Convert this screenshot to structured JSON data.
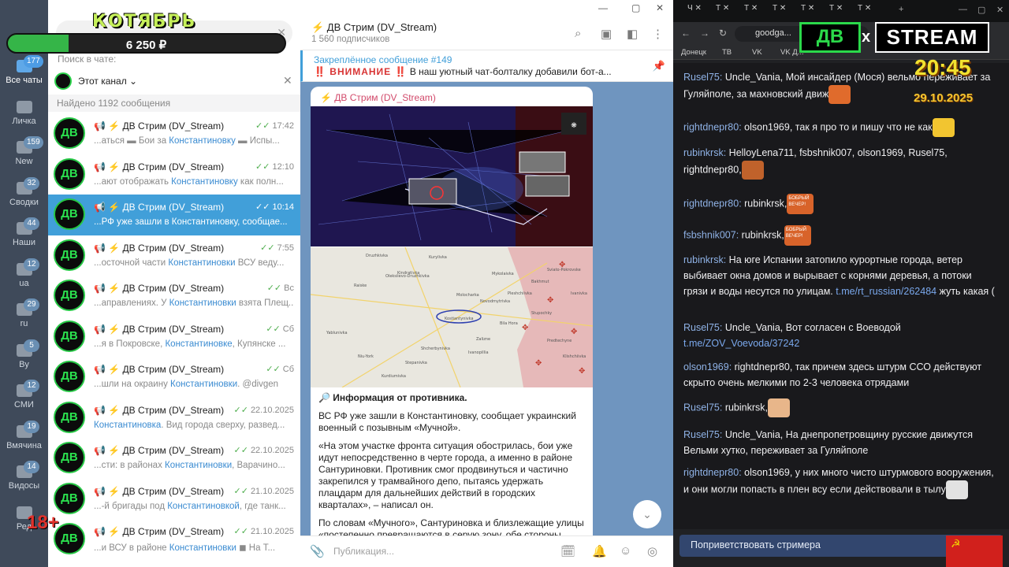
{
  "overlay": {
    "month_title": "КОТЯБРЬ",
    "goal_amount": "6 250 ₽",
    "goal_progress_percent": 22,
    "age_rating": "18+"
  },
  "folders": [
    {
      "label": "Все чаты",
      "badge": "177",
      "active": true
    },
    {
      "label": "Личка",
      "badge": ""
    },
    {
      "label": "New",
      "badge": "159"
    },
    {
      "label": "Сводки",
      "badge": "32"
    },
    {
      "label": "Наши",
      "badge": "44"
    },
    {
      "label": "ua",
      "badge": "12"
    },
    {
      "label": "ru",
      "badge": "29"
    },
    {
      "label": "By",
      "badge": "5"
    },
    {
      "label": "СМИ",
      "badge": "12"
    },
    {
      "label": "Вмячина",
      "badge": "19"
    },
    {
      "label": "Видосы",
      "badge": "14"
    },
    {
      "label": "Ред",
      "badge": ""
    }
  ],
  "search": {
    "in_chat_label": "Поиск в чате:",
    "channel_filter": "Этот канал",
    "found_count": "Найдено 1192 сообщения"
  },
  "results": [
    {
      "title": "📢 ⚡ ДВ Стрим (DV_Stream)",
      "time": "17:42",
      "pre": "...аться ▬ Бои за ",
      "hl": "Константиновку",
      "post": " ▬ Испы..."
    },
    {
      "title": "📢 ⚡ ДВ Стрим (DV_Stream)",
      "time": "12:10",
      "pre": "...ают отображать ",
      "hl": "Константиновку",
      "post": " как полн..."
    },
    {
      "title": "📢 ⚡ ДВ Стрим (DV_Stream)",
      "time": "10:14",
      "pre": "...РФ уже зашли в Константиновку, сообщае...",
      "hl": "",
      "post": "",
      "active": true
    },
    {
      "title": "📢 ⚡ ДВ Стрим (DV_Stream)",
      "time": "7:55",
      "pre": "...осточной части ",
      "hl": "Константиновки",
      "post": " ВСУ веду..."
    },
    {
      "title": "📢 ⚡ ДВ Стрим (DV_Stream)",
      "time": "Вс",
      "pre": "...аправлениях. У ",
      "hl": "Константиновки",
      "post": " взята Плещ..."
    },
    {
      "title": "📢 ⚡ ДВ Стрим (DV_Stream)",
      "time": "Сб",
      "pre": "...я в Покровске, ",
      "hl": "Константиновке",
      "post": ", Купянске ..."
    },
    {
      "title": "📢 ⚡ ДВ Стрим (DV_Stream)",
      "time": "Сб",
      "pre": "...шли на окраину ",
      "hl": "Константиновки",
      "post": ". @divgen"
    },
    {
      "title": "📢 ⚡ ДВ Стрим (DV_Stream)",
      "time": "22.10.2025",
      "pre": "",
      "hl": "Константиновка",
      "post": ". Вид города сверху, развед..."
    },
    {
      "title": "📢 ⚡ ДВ Стрим (DV_Stream)",
      "time": "22.10.2025",
      "pre": "...сти: в районах ",
      "hl": "Константиновки",
      "post": ", Варачино..."
    },
    {
      "title": "📢 ⚡ ДВ Стрим (DV_Stream)",
      "time": "21.10.2025",
      "pre": "...-й бригады под ",
      "hl": "Константиновкой",
      "post": ", где танк..."
    },
    {
      "title": "📢 ⚡ ДВ Стрим (DV_Stream)",
      "time": "21.10.2025",
      "pre": "...и ВСУ в районе ",
      "hl": "Константиновки",
      "post": " ◼ На Т..."
    }
  ],
  "chat": {
    "name": "⚡ ДВ Стрим (DV_Stream)",
    "subscribers": "1 560 подписчиков",
    "pinned_title": "Закреплённое сообщение #149",
    "pinned_warn": "‼️ ВНИМАНИЕ ‼️",
    "pinned_text": "В наш уютный чат-болталку добавили бот-а...",
    "sender": "⚡ ДВ Стрим (DV_Stream)",
    "info_heading": "🔎 Информация от противника.",
    "para1": "ВС РФ уже зашли в Константиновку, сообщает украинский военный с позывным «Мучной».",
    "para2": "«На этом участке фронта ситуация обострилась, бои уже идут непосредственно в черте города, а именно в районе Сантуриновки. Противник смог продвинуться и частично закрепился у трамвайного депо, пытаясь удержать плацдарм для дальнейших действий в городских кварталах», – написал он.",
    "para3": "По словам «Мучного», Сантуриновка и близлежащие улицы «постепенно превращаются в серую зону, обе стороны несут...",
    "composer_placeholder": "Публикация..."
  },
  "map_labels": [
    "Druzhkivka",
    "Kurylivka",
    "Oleksiievo-Druzhkivka",
    "Kindrativka",
    "Raiske",
    "Mykolaivka",
    "Molocharka",
    "Novodmytrivka",
    "Kostiantynivka",
    "Stupochky",
    "Bila Hora",
    "Zalizne",
    "Ivanopillia",
    "Shcherbynivka",
    "Niu-York",
    "Stepanivka",
    "Kurdiumivka",
    "Predtechyne",
    "Klishchiivka",
    "Bakhmut",
    "Sviato-Pokrovske",
    "Ivanivka",
    "Pleshchiivka",
    "Yablunivka"
  ],
  "browser": {
    "tabs": [
      "Ч",
      "Т",
      "Т",
      "Т",
      "Т",
      "Т",
      "Т"
    ],
    "url": "goodga...",
    "bookmarks": [
      "Донецк",
      "ТВ",
      "VK",
      "VK Д..."
    ]
  },
  "stream_logo": {
    "left": "ДВ",
    "x": "x",
    "right": "STREAM"
  },
  "clock": {
    "time": "20:45",
    "date": "29.10.2025"
  },
  "stream_chat": [
    {
      "user": "Rusel75:",
      "text": " Uncle_Vania, Мой инсайдер (Мося) вельмо переживает за Гуляйполе, за махновский движ",
      "emote": "worker"
    },
    {
      "user": "rightdnepr80:",
      "text": " olson1969, так я про то и пишу что не как",
      "emote": "smile"
    },
    {
      "user": "rubinkrsk:",
      "text": " HelloyLena711, fsbshnik007, olson1969, Rusel75, rightdnepr80,",
      "emote": "bear"
    },
    {
      "user": "rightdnepr80:",
      "text": " rubinkrsk,",
      "emote": "bobr",
      "emote_text": "БОБРЫЙ ВЕЧЕР!"
    },
    {
      "user": "fsbshnik007:",
      "text": " rubinkrsk,",
      "emote": "bobr",
      "emote_text": "БОБРЫЙ ВЕЧЕР!"
    },
    {
      "user": "rubinkrsk:",
      "text": " На юге Испании затопило курортные города, ветер выбивает окна домов и вырывает с корнями деревья, а потоки грязи и воды несутся по улицам. ",
      "link": "t.me/rt_russian/262484",
      "after": " жуть какая (",
      "emote": ""
    },
    {
      "user": "Rusel75:",
      "text": " Uncle_Vania, Вот согласен с Воеводой ",
      "link": "t.me/ZOV_Voevoda/37242",
      "after": "",
      "emote": ""
    },
    {
      "user": "olson1969:",
      "text": " rightdnepr80, так причем здесь штурм ССО действуют скрыто очень мелкими по 2-3 человека отрядами",
      "emote": ""
    },
    {
      "user": "Rusel75:",
      "text": " rubinkrsk,",
      "emote": "rock"
    },
    {
      "user": "Rusel75:",
      "text": " Uncle_Vania, На днепропетровщину русские движутся Вельми хутко, переживает за Гуляйполе",
      "emote": ""
    },
    {
      "user": "rightdnepr80:",
      "text": " olson1969, у них много чисто штурмового вооружения, и они могли попасть в плен всу если действовали в тылу",
      "emote": "guy"
    }
  ],
  "greet_button": "Поприветствовать стримера",
  "colors": {
    "accent": "#419fd9",
    "stream_green": "#2bd94a",
    "chat_user": "#8fb2e6"
  }
}
